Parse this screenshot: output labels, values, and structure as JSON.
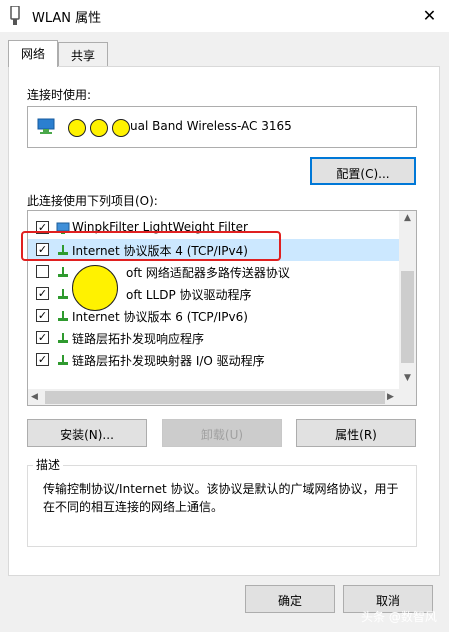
{
  "window": {
    "title": "WLAN 属性",
    "close_glyph": "✕"
  },
  "tabs": [
    {
      "label": "网络"
    },
    {
      "label": "共享"
    }
  ],
  "connect_using": {
    "label": "连接时使用:",
    "adapter_text": "ual Band Wireless-AC 3165"
  },
  "buttons": {
    "configure": "配置(C)...",
    "install": "安装(N)...",
    "uninstall": "卸载(U)",
    "properties": "属性(R)",
    "ok": "确定",
    "cancel": "取消"
  },
  "items_label": "此连接使用下列项目(O):",
  "items": [
    {
      "text": "WinpkFilter LightWeight Filter",
      "checked": true,
      "icon": "network-monitor-icon"
    },
    {
      "text": "Internet 协议版本 4 (TCP/IPv4)",
      "checked": true,
      "icon": "protocol-icon",
      "selected": true
    },
    {
      "text": "oft 网络适配器多路传送器协议",
      "checked": false,
      "icon": "protocol-icon"
    },
    {
      "text": "oft LLDP 协议驱动程序",
      "checked": true,
      "icon": "protocol-icon"
    },
    {
      "text": "Internet 协议版本 6 (TCP/IPv6)",
      "checked": true,
      "icon": "protocol-icon"
    },
    {
      "text": "链路层拓扑发现响应程序",
      "checked": true,
      "icon": "protocol-icon"
    },
    {
      "text": "链路层拓扑发现映射器 I/O 驱动程序",
      "checked": true,
      "icon": "protocol-icon"
    }
  ],
  "description": {
    "legend": "描述",
    "text": "传输控制协议/Internet 协议。该协议是默认的广域网络协议，用于在不同的相互连接的网络上通信。"
  },
  "watermark": "头条 @数智风",
  "colors": {
    "accent": "#0078d7",
    "highlight_frame": "#e02020",
    "selection": "#cce8ff",
    "redaction": "#fff200"
  }
}
